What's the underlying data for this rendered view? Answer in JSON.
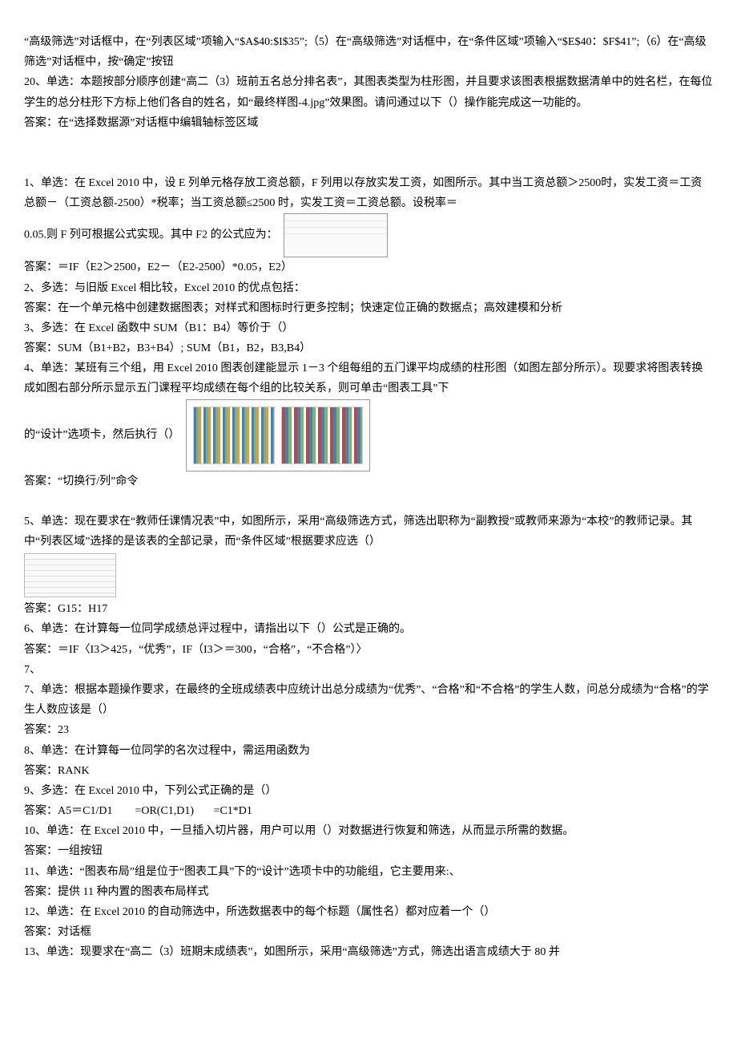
{
  "top": {
    "p1": "“高级筛选”对话框中，在“列表区域”项输入“$A$40:$I$35”;（5）在“高级筛选”对话框中，在“条件区域”项输入“$E$40：$F$41”;（6）在“高级筛选”对话框中，按“确定”按钮",
    "p2": "20、单选：本题按部分顺序创建“高二（3）班前五名总分排名表”，其图表类型为柱形图，并且要求该图表根据数据清单中的姓名栏，在每位学生的总分柱形下方标上他们各自的姓名，如“最终样图-4.jpg”效果图。请问通过以下（）操作能完成这一功能的。",
    "p3": "答案：在“选择数据源”对话框中编辑轴标签区域"
  },
  "q1": {
    "line1": "1、单选：在 Excel 2010 中，设 E 列单元格存放工资总额，F 列用以存放实发工资，如图所示。其中当工资总额＞2500时，实发工资＝工资总额－（工资总额-2500）*税率；当工资总额≤2500 时，实发工资＝工资总额。设税率＝",
    "line2_prefix": "0.05.则 F 列可根据公式实现。其中 F2 的公式应为：",
    "ans": "答案：＝IF（E2＞2500，E2－（E2-2500）*0.05，E2）"
  },
  "q2": {
    "q": "2、多选：与旧版 Excel 相比较，Excel 2010 的优点包括：",
    "ans": "答案：在一个单元格中创建数据图表；对样式和图标时行更多控制；快速定位正确的数据点；高效建模和分析"
  },
  "q3": {
    "q": "3、多选：在 Excel 函数中 SUM（B1：B4）等价于（）",
    "ans": "答案：SUM（B1+B2，B3+B4）; SUM（B1，B2，B3,B4）"
  },
  "q4": {
    "q": "4、单选：某班有三个组，用 Excel 2010 图表创建能显示 1－3 个组每组的五门课平均成绩的柱形图（如图左部分所示）。现要求将图表转换成如图右部分所示显示五门课程平均成绩在每个组的比较关系，则可单击“图表工具”下",
    "suffix": "的“设计”选项卡，然后执行（）",
    "ans": "答案：“切换行/列”命令"
  },
  "q5": {
    "q": "5、单选：现在要求在“教师任课情况表”中，如图所示，采用“高级筛选方式，筛选出职称为“副教授”或教师来源为“本校”的教师记录。其中“列表区域”选择的是该表的全部记录，而“条件区域”根据要求应选（）",
    "ans": "答案：G15：H17"
  },
  "q6": {
    "q": "6、单选：在计算每一位同学成绩总评过程中，请指出以下（）公式是正确的。",
    "ans": "答案：＝IF〈I3＞425，“优秀”，IF（I3＞＝300，“合格”，“不合格”）〉"
  },
  "q7extra": "7、",
  "q7": {
    "q": "7、单选：根据本题操作要求，在最终的全班成绩表中应统计出总分成绩为“优秀”、“合格”和“不合格”的学生人数，问总分成绩为“合格”的学生人数应该是（）",
    "ans": "答案：23"
  },
  "q8": {
    "q": "8、单选：在计算每一位同学的名次过程中，需运用函数为",
    "ans": "答案：RANK"
  },
  "q9": {
    "q": "9、多选：在 Excel 2010 中，下列公式正确的是（）",
    "ans": "答案：A5＝C1/D1        =OR(C1,D1)       =C1*D1"
  },
  "q10": {
    "q": "10、单选：在 Excel 2010 中，一旦插入切片器，用户可以用（）对数据进行恢复和筛选，从而显示所需的数据。",
    "ans": "答案：一组按钮"
  },
  "q11": {
    "q": "11、单选：“图表布局”组是位于“图表工具”下的“设计”选项卡中的功能组，它主要用来:、",
    "ans": "答案：提供 11 种内置的图表布局样式"
  },
  "q12": {
    "q": "12、单选：在 Excel 2010 的自动筛选中，所选数据表中的每个标题（属性名）都对应着一个（）",
    "ans": "答案：对话框"
  },
  "q13": {
    "q": "13、单选：现要求在“高二（3）班期末成绩表”，如图所示，采用“高级筛选”方式，筛选出语言成绩大于 80 并"
  }
}
